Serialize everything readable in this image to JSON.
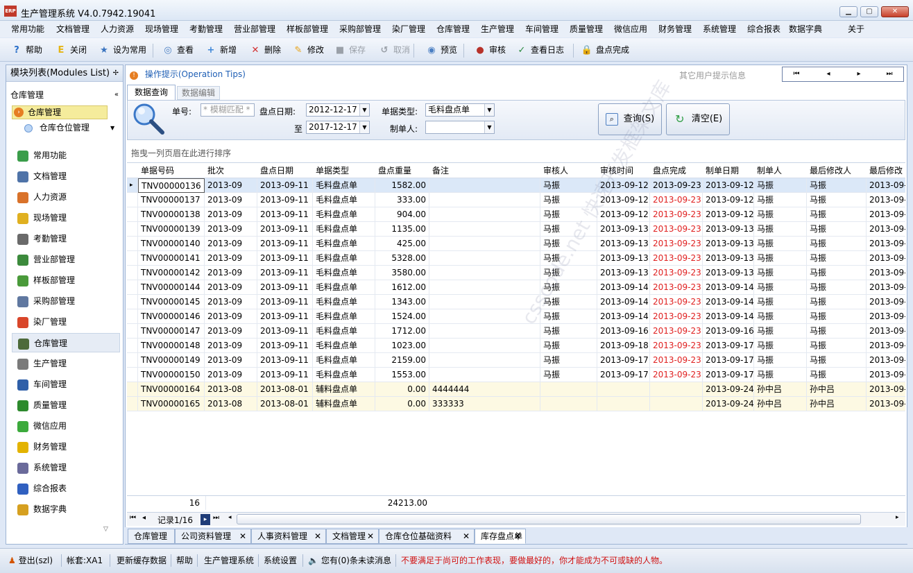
{
  "window": {
    "title": "生产管理系统 V4.0.7942.19041",
    "logo_text": "ERP"
  },
  "menu": [
    "常用功能",
    "文档管理",
    "人力资源",
    "现场管理",
    "考勤管理",
    "营业部管理",
    "样板部管理",
    "采购部管理",
    "染厂管理",
    "仓库管理",
    "生产管理",
    "车间管理",
    "质量管理",
    "微信应用",
    "财务管理",
    "系统管理",
    "综合报表",
    "数据字典",
    "关于"
  ],
  "toolbar": [
    {
      "label": "帮助",
      "icon": "help-icon"
    },
    {
      "label": "关闭",
      "icon": "exit-icon"
    },
    {
      "label": "设为常用",
      "icon": "favorite-icon"
    },
    {
      "label": "查看",
      "icon": "view-icon"
    },
    {
      "label": "新增",
      "icon": "add-icon"
    },
    {
      "label": "删除",
      "icon": "delete-icon"
    },
    {
      "label": "修改",
      "icon": "edit-icon"
    },
    {
      "label": "保存",
      "icon": "save-icon"
    },
    {
      "label": "取消",
      "icon": "cancel-icon"
    },
    {
      "label": "预览",
      "icon": "preview-icon"
    },
    {
      "label": "审核",
      "icon": "audit-icon"
    },
    {
      "label": "查看日志",
      "icon": "log-icon"
    },
    {
      "label": "盘点完成",
      "icon": "lock-icon"
    }
  ],
  "left": {
    "header": "模块列表(Modules List)",
    "group": "仓库管理",
    "selected": "仓库管理",
    "sub": "仓库仓位管理",
    "items": [
      "常用功能",
      "文档管理",
      "人力资源",
      "现场管理",
      "考勤管理",
      "营业部管理",
      "样板部管理",
      "采购部管理",
      "染厂管理",
      "仓库管理",
      "生产管理",
      "车间管理",
      "质量管理",
      "微信应用",
      "财务管理",
      "系统管理",
      "综合报表",
      "数据字典"
    ]
  },
  "tips": {
    "label": "操作提示(Operation Tips)",
    "other": "其它用户提示信息"
  },
  "tabs": {
    "query": "数据查询",
    "edit": "数据编辑"
  },
  "query": {
    "no_label": "单号:",
    "no_placeholder": "* 模糊匹配 *",
    "date_label": "盘点日期:",
    "date_from": "2012-12-17",
    "to_label": "至",
    "date_to": "2017-12-17",
    "type_label": "单据类型:",
    "type_value": "毛料盘点单",
    "maker_label": "制单人:",
    "maker_value": "",
    "search_btn": "查询(S)",
    "clear_btn": "清空(E)"
  },
  "group_hint": "拖曳一列页眉在此进行排序",
  "grid": {
    "columns": [
      "单据号码",
      "批次",
      "盘点日期",
      "单据类型",
      "盘点重量",
      "备注",
      "审核人",
      "审核时间",
      "盘点完成",
      "制单日期",
      "制单人",
      "最后修改人",
      "最后修改"
    ],
    "rows": [
      [
        "TNV00000136",
        "2013-09",
        "2013-09-11",
        "毛料盘点单",
        "1582.00",
        "",
        "马振",
        "2013-09-12",
        "2013-09-23",
        "2013-09-12",
        "马振",
        "马振",
        "2013-09-"
      ],
      [
        "TNV00000137",
        "2013-09",
        "2013-09-11",
        "毛料盘点单",
        "333.00",
        "",
        "马振",
        "2013-09-12",
        "2013-09-23",
        "2013-09-12",
        "马振",
        "马振",
        "2013-09-"
      ],
      [
        "TNV00000138",
        "2013-09",
        "2013-09-11",
        "毛料盘点单",
        "904.00",
        "",
        "马振",
        "2013-09-12",
        "2013-09-23",
        "2013-09-12",
        "马振",
        "马振",
        "2013-09-"
      ],
      [
        "TNV00000139",
        "2013-09",
        "2013-09-11",
        "毛料盘点单",
        "1135.00",
        "",
        "马振",
        "2013-09-13",
        "2013-09-23",
        "2013-09-13",
        "马振",
        "马振",
        "2013-09-"
      ],
      [
        "TNV00000140",
        "2013-09",
        "2013-09-11",
        "毛料盘点单",
        "425.00",
        "",
        "马振",
        "2013-09-13",
        "2013-09-23",
        "2013-09-13",
        "马振",
        "马振",
        "2013-09-"
      ],
      [
        "TNV00000141",
        "2013-09",
        "2013-09-11",
        "毛料盘点单",
        "5328.00",
        "",
        "马振",
        "2013-09-13",
        "2013-09-23",
        "2013-09-13",
        "马振",
        "马振",
        "2013-09-"
      ],
      [
        "TNV00000142",
        "2013-09",
        "2013-09-11",
        "毛料盘点单",
        "3580.00",
        "",
        "马振",
        "2013-09-13",
        "2013-09-23",
        "2013-09-13",
        "马振",
        "马振",
        "2013-09-"
      ],
      [
        "TNV00000144",
        "2013-09",
        "2013-09-11",
        "毛料盘点单",
        "1612.00",
        "",
        "马振",
        "2013-09-14",
        "2013-09-23",
        "2013-09-14",
        "马振",
        "马振",
        "2013-09-"
      ],
      [
        "TNV00000145",
        "2013-09",
        "2013-09-11",
        "毛料盘点单",
        "1343.00",
        "",
        "马振",
        "2013-09-14",
        "2013-09-23",
        "2013-09-14",
        "马振",
        "马振",
        "2013-09-"
      ],
      [
        "TNV00000146",
        "2013-09",
        "2013-09-11",
        "毛料盘点单",
        "1524.00",
        "",
        "马振",
        "2013-09-14",
        "2013-09-23",
        "2013-09-14",
        "马振",
        "马振",
        "2013-09-"
      ],
      [
        "TNV00000147",
        "2013-09",
        "2013-09-11",
        "毛料盘点单",
        "1712.00",
        "",
        "马振",
        "2013-09-16",
        "2013-09-23",
        "2013-09-16",
        "马振",
        "马振",
        "2013-09-"
      ],
      [
        "TNV00000148",
        "2013-09",
        "2013-09-11",
        "毛料盘点单",
        "1023.00",
        "",
        "马振",
        "2013-09-18",
        "2013-09-23",
        "2013-09-17",
        "马振",
        "马振",
        "2013-09-"
      ],
      [
        "TNV00000149",
        "2013-09",
        "2013-09-11",
        "毛料盘点单",
        "2159.00",
        "",
        "马振",
        "2013-09-17",
        "2013-09-23",
        "2013-09-17",
        "马振",
        "马振",
        "2013-09-"
      ],
      [
        "TNV00000150",
        "2013-09",
        "2013-09-11",
        "毛料盘点单",
        "1553.00",
        "",
        "马振",
        "2013-09-17",
        "2013-09-23",
        "2013-09-17",
        "马振",
        "马振",
        "2013-09-"
      ],
      [
        "TNV00000164",
        "2013-08",
        "2013-08-01",
        "辅料盘点单",
        "0.00",
        "4444444",
        "",
        "",
        "",
        "2013-09-24",
        "孙中吕",
        "孙中吕",
        "2013-09-"
      ],
      [
        "TNV00000165",
        "2013-08",
        "2013-08-01",
        "辅料盘点单",
        "0.00",
        "333333",
        "",
        "",
        "",
        "2013-09-24",
        "孙中吕",
        "孙中吕",
        "2013-09-"
      ]
    ],
    "footer_count": "16",
    "footer_weight": "24213.00",
    "pager_text": "记录1/16"
  },
  "doc_tabs": [
    "仓库管理",
    "公司资料管理",
    "人事资料管理",
    "文档管理",
    "仓库仓位基础资料",
    "库存盘点单"
  ],
  "status": {
    "logout": "登出(szl)",
    "account": "帐套:XA1",
    "refresh": "更新缓存数据",
    "help": "帮助",
    "system": "生产管理系统",
    "settings": "系统设置",
    "messages": "您有(0)条未读消息",
    "motto": "不要满足于尚可的工作表现，要做最好的，你才能成为不可或缺的人物。"
  },
  "watermark": "csscode.net 快速开发框架文库",
  "colors": {
    "accent": "#1f5fb5",
    "highlight_row": "#fdf9e3",
    "selected_row": "#dbe8f8",
    "red_text": "#e02020"
  }
}
